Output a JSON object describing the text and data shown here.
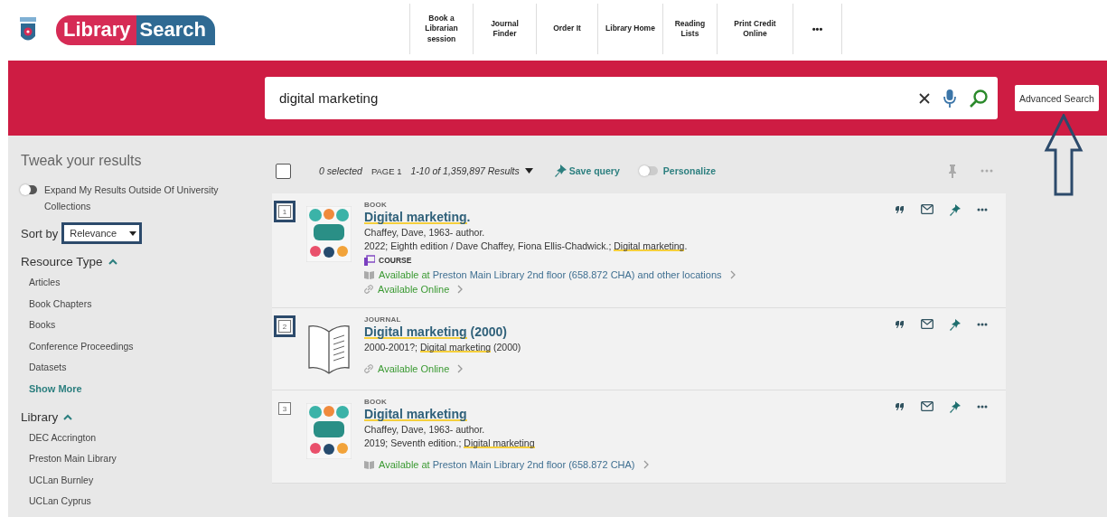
{
  "header": {
    "logo": {
      "word_1": "Library",
      "word_2": "Search"
    },
    "nav": [
      {
        "label": "Book a Librarian session"
      },
      {
        "label": "Journal Finder"
      },
      {
        "label": "Order It"
      },
      {
        "label": "Library Home"
      },
      {
        "label": "Reading Lists"
      },
      {
        "label": "Print Credit Online"
      },
      {
        "label": "•••"
      }
    ]
  },
  "search": {
    "value": "digital marketing",
    "advanced_button": "Advanced Search"
  },
  "sidebar": {
    "title": "Tweak your results",
    "expand_toggle": {
      "label": "Expand My Results Outside Of University Collections",
      "on": false
    },
    "sort": {
      "label": "Sort by",
      "value": "Relevance",
      "highlighted": true
    },
    "facets": [
      {
        "title": "Resource Type",
        "expanded": true,
        "items": [
          "Articles",
          "Book Chapters",
          "Books",
          "Conference Proceedings",
          "Datasets"
        ],
        "show_more": "Show More"
      },
      {
        "title": "Library",
        "expanded": true,
        "items": [
          "DEC Accrington",
          "Preston Main Library",
          "UCLan Burnley",
          "UCLan Cyprus"
        ]
      }
    ]
  },
  "toolbar": {
    "select_all": {
      "checked": false
    },
    "selected_count": "0 selected",
    "page": "PAGE 1",
    "range": "1-10 of 1,359,897 Results",
    "save_query": "Save query",
    "personalize": {
      "label": "Personalize",
      "on": false
    }
  },
  "results": [
    {
      "number": "1",
      "highlighted": true,
      "kind": "book",
      "type": "BOOK",
      "title": [
        {
          "text": "Digital marketing",
          "match": true
        },
        {
          "text": ".",
          "match": false
        }
      ],
      "lines": [
        [
          {
            "text": "Chaffey, Dave, 1963- author.",
            "match": false
          }
        ],
        [
          {
            "text": "2022; Eighth edition / Dave Chaffey, Fiona Ellis-Chadwick.; ",
            "match": false
          },
          {
            "text": "Digital marketing",
            "match": true
          },
          {
            "text": ".",
            "match": false
          }
        ]
      ],
      "course": "COURSE",
      "availability": [
        {
          "kind": "physical",
          "status": "Available at",
          "location": "Preston Main Library",
          "detail": "2nd floor (658.872 CHA) and other locations"
        },
        {
          "kind": "online",
          "status": "Available Online"
        }
      ]
    },
    {
      "number": "2",
      "highlighted": true,
      "kind": "journal",
      "type": "JOURNAL",
      "title": [
        {
          "text": "Digital marketing",
          "match": true
        },
        {
          "text": " (2000)",
          "match": false
        }
      ],
      "lines": [
        [
          {
            "text": "2000-2001?; ",
            "match": false
          },
          {
            "text": "Digital marketing",
            "match": true
          },
          {
            "text": " (2000)",
            "match": false
          }
        ]
      ],
      "availability": [
        {
          "kind": "online",
          "status": "Available Online"
        }
      ]
    },
    {
      "number": "3",
      "highlighted": false,
      "kind": "book",
      "type": "BOOK",
      "title": [
        {
          "text": "Digital marketing",
          "match": true
        }
      ],
      "lines": [
        [
          {
            "text": "Chaffey, Dave, 1963- author.",
            "match": false
          }
        ],
        [
          {
            "text": "2019; Seventh edition.; ",
            "match": false
          },
          {
            "text": "Digital marketing",
            "match": true
          }
        ]
      ],
      "availability": [
        {
          "kind": "physical",
          "status": "Available at",
          "location": "Preston Main Library",
          "detail": "2nd floor (658.872 CHA)"
        }
      ]
    }
  ]
}
